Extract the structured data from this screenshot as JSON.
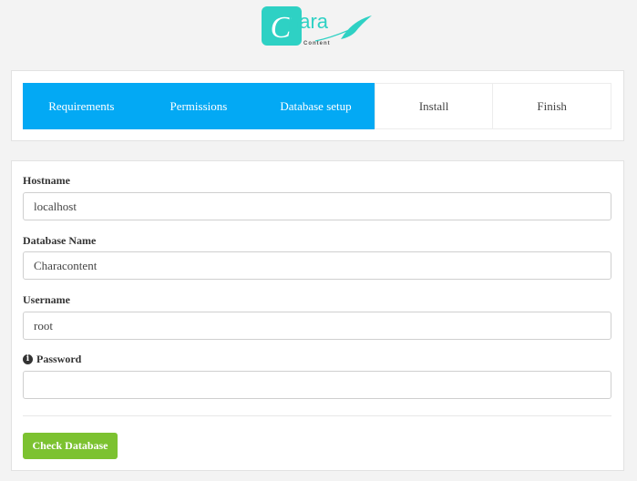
{
  "logo": {
    "text": "hara",
    "sub": "Content"
  },
  "steps": [
    {
      "label": "Requirements",
      "active": true
    },
    {
      "label": "Permissions",
      "active": true
    },
    {
      "label": "Database setup",
      "active": true
    },
    {
      "label": "Install",
      "active": false
    },
    {
      "label": "Finish",
      "active": false
    }
  ],
  "form": {
    "hostname": {
      "label": "Hostname",
      "value": "localhost"
    },
    "database_name": {
      "label": "Database Name",
      "value": "Characontent"
    },
    "username": {
      "label": "Username",
      "value": "root"
    },
    "password": {
      "label": "Password",
      "value": ""
    },
    "check_button": "Check Database"
  },
  "colors": {
    "active_step": "#03a9f4",
    "button": "#7cc230",
    "logo_accent": "#2ed1c4"
  }
}
